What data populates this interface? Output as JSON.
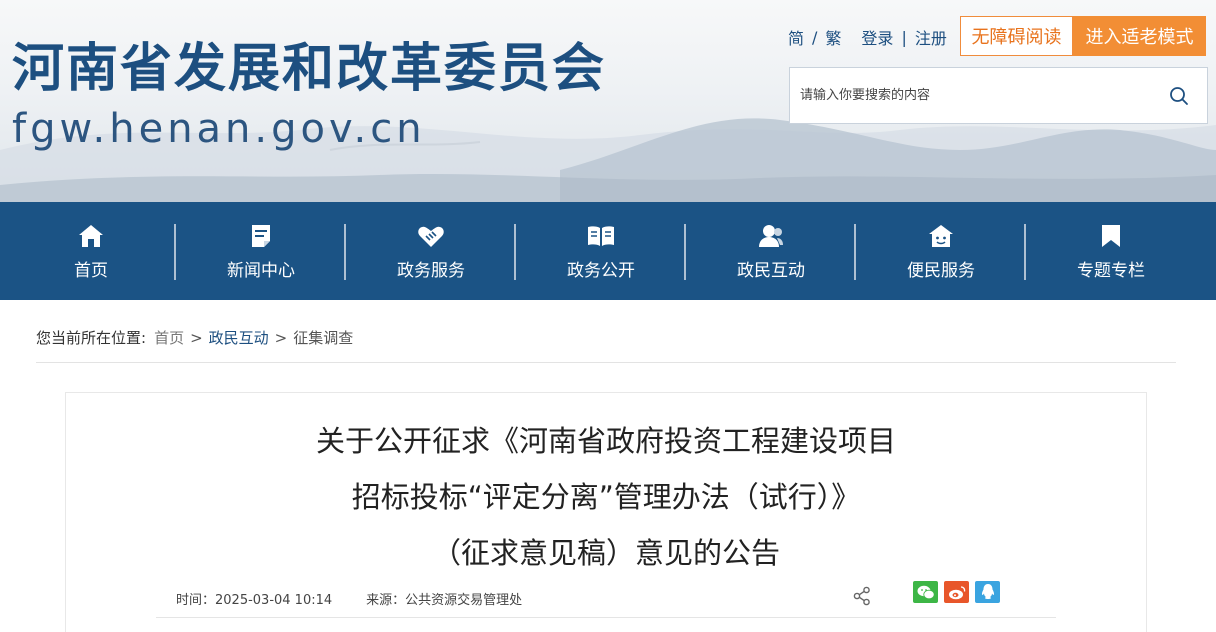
{
  "header": {
    "site_title": "河南省发展和改革委员会",
    "site_domain": "fgw.henan.gov.cn",
    "lang_simplified": "简",
    "lang_traditional": "繁",
    "login": "登录",
    "register": "注册",
    "accessibility_button": "无障碍阅读",
    "elder_mode_button": "进入适老模式",
    "search_placeholder": "请输入你要搜索的内容"
  },
  "nav": {
    "items": [
      {
        "label": "首页",
        "icon": "home-icon"
      },
      {
        "label": "新闻中心",
        "icon": "news-icon"
      },
      {
        "label": "政务服务",
        "icon": "handshake-icon"
      },
      {
        "label": "政务公开",
        "icon": "open-book-icon"
      },
      {
        "label": "政民互动",
        "icon": "user-icon"
      },
      {
        "label": "便民服务",
        "icon": "house-smile-icon"
      },
      {
        "label": "专题专栏",
        "icon": "bookmark-icon"
      }
    ]
  },
  "breadcrumb": {
    "prefix": "您当前所在位置:",
    "items": [
      "首页",
      "政民互动",
      "征集调查"
    ]
  },
  "article": {
    "title_lines": [
      "关于公开征求《河南省政府投资工程建设项目",
      "招标投标“评定分离”管理办法（试行）》",
      "（征求意见稿）意见的公告"
    ],
    "time_label": "时间：2025-03-04 10:14",
    "source_label": "来源：公共资源交易管理处",
    "share_icons": [
      "share-icon",
      "wechat-icon",
      "weibo-icon",
      "qq-icon"
    ]
  },
  "colors": {
    "nav_bg": "#1b5385",
    "brand_blue": "#1d4f80",
    "accent_orange": "#f28e35"
  }
}
